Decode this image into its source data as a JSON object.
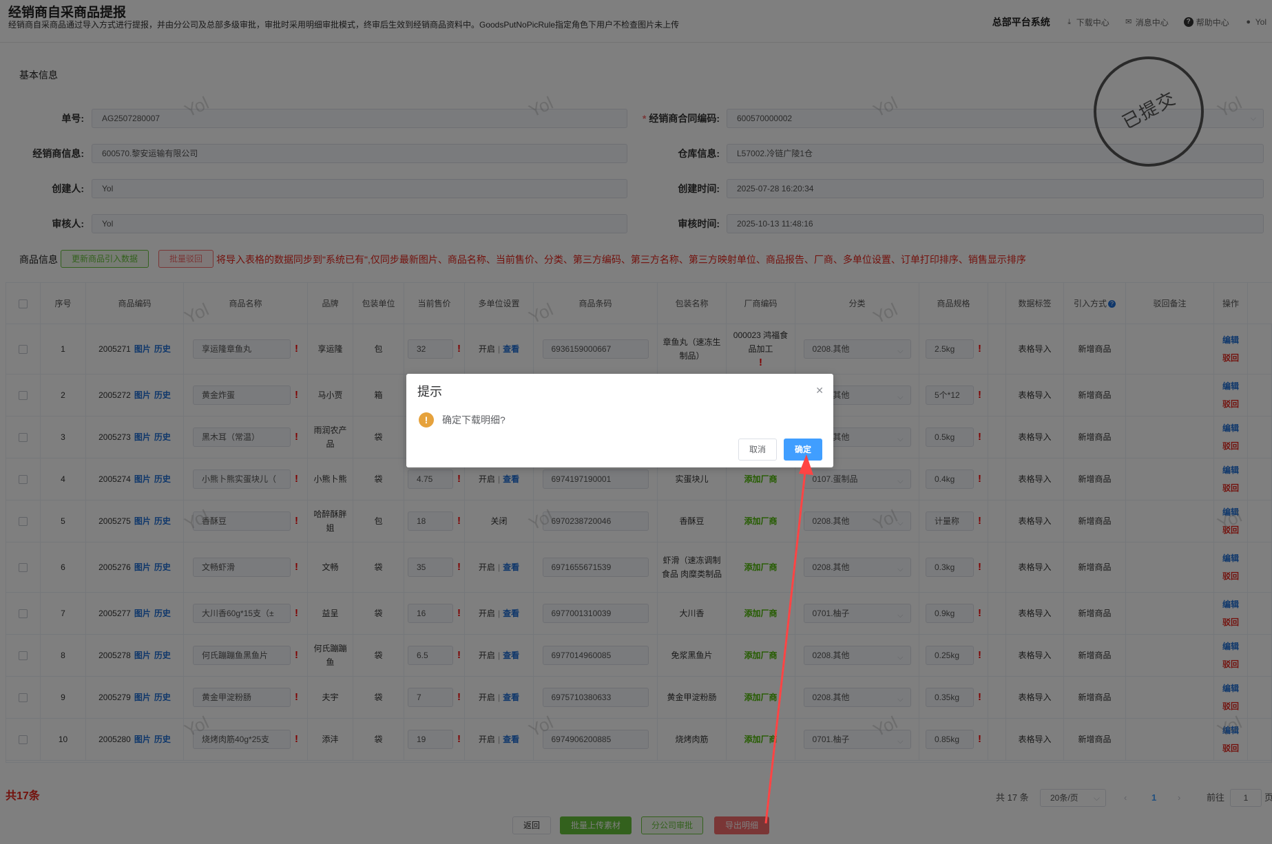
{
  "header": {
    "title": "经销商自采商品提报",
    "subtitle": "经销商自采商品通过导入方式进行提报，并由分公司及总部多级审批，审批时采用明细审批模式，终审后生效到经销商品资料中。GoodsPutNoPicRule指定角色下用户不检查图片未上传",
    "platform": "总部平台系统",
    "download": "下载中心",
    "message": "消息中心",
    "help": "帮助中心",
    "user": "Yol"
  },
  "basic": {
    "section_title": "基本信息",
    "order_no_label": "单号:",
    "order_no": "AG2507280007",
    "contract_label": "经销商合同编码:",
    "contract": "600570000002",
    "dealer_label": "经销商信息:",
    "dealer": "600570.黎安运输有限公司",
    "warehouse_label": "仓库信息:",
    "warehouse": "L57002.冷链广陵1仓",
    "creator_label": "创建人:",
    "creator": "Yol",
    "created_label": "创建时间:",
    "created": "2025-07-28 16:20:34",
    "auditor_label": "审核人:",
    "auditor": "Yol",
    "audit_label": "审核时间:",
    "audit_time": "2025-10-13 11:48:16",
    "stamp": "已提交"
  },
  "product_bar": {
    "label": "商品信息",
    "update_btn": "更新商品引入数据",
    "reject_btn": "批量驳回",
    "note": "将导入表格的数据同步到\"系统已有\",仅同步最新图片、商品名称、当前售价、分类、第三方编码、第三方名称、第三方映射单位、商品报告、厂商、多单位设置、订单打印排序、销售显示排序"
  },
  "table": {
    "headers": [
      "序号",
      "商品编码",
      "商品名称",
      "品牌",
      "包装单位",
      "当前售价",
      "多单位设置",
      "商品条码",
      "包装名称",
      "厂商编码",
      "分类",
      "商品规格",
      "",
      "数据标签",
      "引入方式",
      "驳回备注",
      "操作"
    ],
    "link_pic": "图片",
    "link_hist": "历史",
    "link_view": "查看",
    "add_vendor": "添加厂商",
    "edit": "编辑",
    "reject": "驳回",
    "rows": [
      {
        "no": "1",
        "code": "2005271",
        "name": "享运隆章鱼丸",
        "brand": "享运隆",
        "unit": "包",
        "price": "32",
        "multi": "开启",
        "barcode": "6936159000667",
        "pkg": "章鱼丸（速冻生制品）",
        "vendor": "000023 鸿福食品加工",
        "cat": "0208.其他",
        "spec": "2.5kg",
        "tag": "表格导入",
        "mode": "新增商品"
      },
      {
        "no": "2",
        "code": "2005272",
        "name": "黄金炸蛋",
        "brand": "马小贾",
        "unit": "箱",
        "price": "",
        "multi": "",
        "barcode": "",
        "pkg": "",
        "vendor": "",
        "cat": "0208.其他",
        "spec": "5个*12",
        "tag": "表格导入",
        "mode": "新增商品"
      },
      {
        "no": "3",
        "code": "2005273",
        "name": "黑木耳（常温）",
        "brand": "雨润农产品",
        "unit": "袋",
        "price": "",
        "multi": "",
        "barcode": "",
        "pkg": "",
        "vendor": "",
        "cat": "0208.其他",
        "spec": "0.5kg",
        "tag": "表格导入",
        "mode": "新增商品"
      },
      {
        "no": "4",
        "code": "2005274",
        "name": "小熊卜熊实蛋块儿（",
        "brand": "小熊卜熊",
        "unit": "袋",
        "price": "4.75",
        "multi": "开启",
        "barcode": "6974197190001",
        "pkg": "实蛋块儿",
        "vendor": "添加厂商",
        "cat": "0107.蛋制品",
        "spec": "0.4kg",
        "tag": "表格导入",
        "mode": "新增商品"
      },
      {
        "no": "5",
        "code": "2005275",
        "name": "香酥豆",
        "brand": "哈醉酥胖姐",
        "unit": "包",
        "price": "18",
        "multi": "关闭",
        "barcode": "6970238720046",
        "pkg": "香酥豆",
        "vendor": "添加厂商",
        "cat": "0208.其他",
        "spec": "计量称",
        "tag": "表格导入",
        "mode": "新增商品"
      },
      {
        "no": "6",
        "code": "2005276",
        "name": "文畅虾滑",
        "brand": "文畅",
        "unit": "袋",
        "price": "35",
        "multi": "开启",
        "barcode": "6971655671539",
        "pkg": "虾滑（速冻调制食品 肉糜类制品",
        "vendor": "添加厂商",
        "cat": "0208.其他",
        "spec": "0.3kg",
        "tag": "表格导入",
        "mode": "新增商品"
      },
      {
        "no": "7",
        "code": "2005277",
        "name": "大川香60g*15支（±",
        "brand": "益呈",
        "unit": "袋",
        "price": "16",
        "multi": "开启",
        "barcode": "6977001310039",
        "pkg": "大川香",
        "vendor": "添加厂商",
        "cat": "0701.柚子",
        "spec": "0.9kg",
        "tag": "表格导入",
        "mode": "新增商品"
      },
      {
        "no": "8",
        "code": "2005278",
        "name": "何氏蹦蹦鱼黑鱼片",
        "brand": "何氏蹦蹦鱼",
        "unit": "袋",
        "price": "6.5",
        "multi": "开启",
        "barcode": "6977014960085",
        "pkg": "免浆黑鱼片",
        "vendor": "添加厂商",
        "cat": "0208.其他",
        "spec": "0.25kg",
        "tag": "表格导入",
        "mode": "新增商品"
      },
      {
        "no": "9",
        "code": "2005279",
        "name": "黄金甲淀粉肠",
        "brand": "夫宇",
        "unit": "袋",
        "price": "7",
        "multi": "开启",
        "barcode": "6975710380633",
        "pkg": "黄金甲淀粉肠",
        "vendor": "添加厂商",
        "cat": "0208.其他",
        "spec": "0.35kg",
        "tag": "表格导入",
        "mode": "新增商品"
      },
      {
        "no": "10",
        "code": "2005280",
        "name": "烧烤肉筋40g*25支",
        "brand": "添沣",
        "unit": "袋",
        "price": "19",
        "multi": "开启",
        "barcode": "6974906200885",
        "pkg": "烧烤肉筋",
        "vendor": "添加厂商",
        "cat": "0701.柚子",
        "spec": "0.85kg",
        "tag": "表格导入",
        "mode": "新增商品"
      }
    ]
  },
  "footer": {
    "total": "共17条",
    "pager_total": "共 17 条",
    "page_size": "20条/页",
    "page": "1",
    "goto_label": "前往",
    "goto_value": "1",
    "page_suffix": "页",
    "back": "返回",
    "upload": "批量上传素材",
    "branch": "分公司审批",
    "export": "导出明细"
  },
  "watermark": "Yol",
  "dialog": {
    "title": "提示",
    "message": "确定下载明细?",
    "cancel": "取消",
    "ok": "确定",
    "warn_icon": "!"
  }
}
